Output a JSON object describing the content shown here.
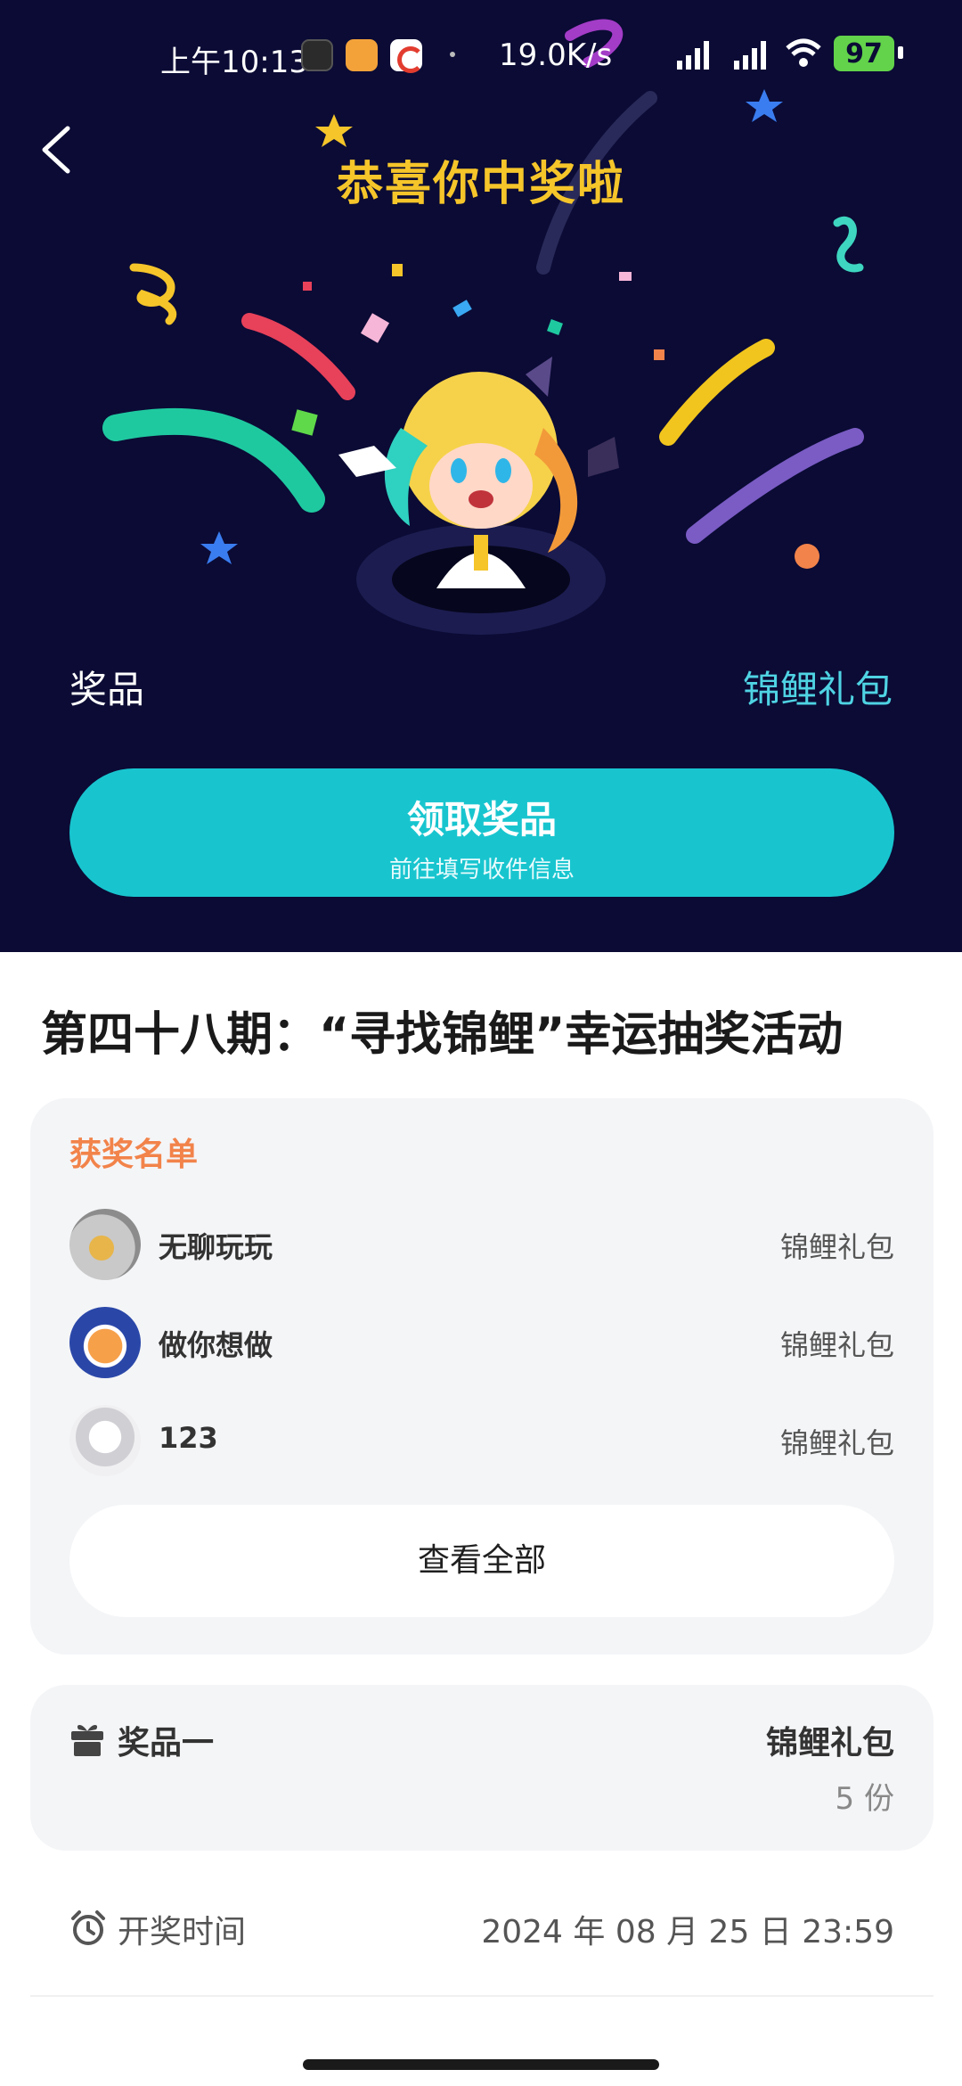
{
  "status_bar": {
    "time": "上午10:13",
    "network_speed": "19.0K/s",
    "battery_level": "97"
  },
  "hero": {
    "title": "恭喜你中奖啦",
    "prize_label": "奖品",
    "prize_value": "锦鲤礼包",
    "claim_button": {
      "title": "领取奖品",
      "subtitle": "前往填写收件信息"
    },
    "colors": {
      "background": "#0b0b35",
      "title": "#f5c52a",
      "accent": "#18c5cf",
      "prize_value": "#4fd3e3"
    }
  },
  "activity": {
    "title": "第四十八期：“寻找锦鲤”幸运抽奖活动"
  },
  "winners": {
    "heading": "获奖名单",
    "list": [
      {
        "name": "无聊玩玩",
        "prize": "锦鲤礼包"
      },
      {
        "name": "做你想做",
        "prize": "锦鲤礼包"
      },
      {
        "name": "123",
        "prize": "锦鲤礼包"
      }
    ],
    "view_all_label": "查看全部",
    "heading_color": "#f2834a"
  },
  "prize_item": {
    "icon": "gift-icon",
    "label": "奖品一",
    "name": "锦鲤礼包",
    "quantity": "5 份"
  },
  "draw_time": {
    "icon": "alarm-clock-icon",
    "label": "开奖时间",
    "value": "2024 年 08 月 25 日 23:59"
  }
}
